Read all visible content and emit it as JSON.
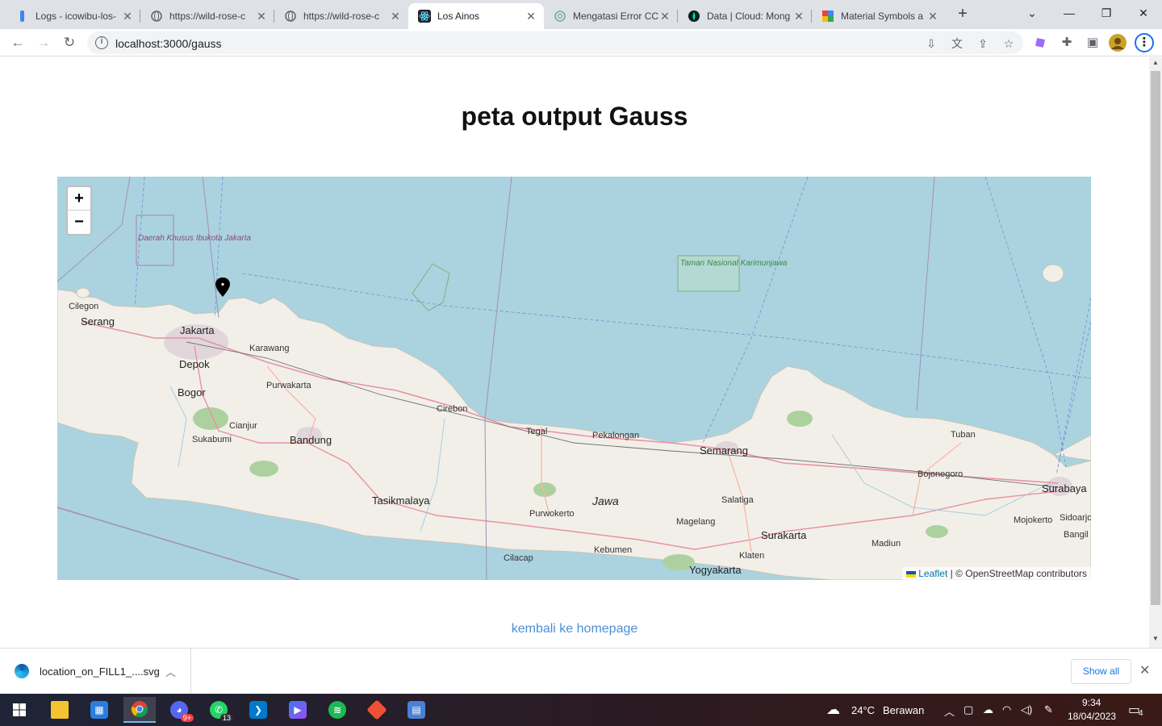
{
  "browser": {
    "tabs": [
      {
        "title": "Logs - icowibu-los-",
        "icon": "gcp-logs-icon"
      },
      {
        "title": "https://wild-rose-c",
        "icon": "globe-icon"
      },
      {
        "title": "https://wild-rose-c",
        "icon": "globe-icon"
      },
      {
        "title": "Los Ainos",
        "icon": "react-icon",
        "active": true
      },
      {
        "title": "Mengatasi Error CC",
        "icon": "openai-icon"
      },
      {
        "title": "Data | Cloud: Mong",
        "icon": "mongodb-icon"
      },
      {
        "title": "Material Symbols a",
        "icon": "material-icon"
      }
    ],
    "url": "localhost:3000/gauss"
  },
  "page": {
    "title": "peta output Gauss",
    "back_link": "kembali ke homepage"
  },
  "map": {
    "zoom_in": "+",
    "zoom_out": "−",
    "attribution_leaflet": "Leaflet",
    "attribution_rest": " | © OpenStreetMap contributors",
    "marker_icon": "location-pin-icon",
    "labels": {
      "dki": "Daerah Khusus Ibukota Jakarta",
      "karimunjawa": "Taman Nasional Karimunjawa",
      "cilegon": "Cilegon",
      "serang": "Serang",
      "jakarta": "Jakarta",
      "karawang": "Karawang",
      "depok": "Depok",
      "bogor": "Bogor",
      "purwakarta": "Purwakarta",
      "cianjur": "Cianjur",
      "sukabumi": "Sukabumi",
      "bandung": "Bandung",
      "cirebon": "Cirebon",
      "tegal": "Tegal",
      "pekalongan": "Pekalongan",
      "semarang": "Semarang",
      "tuban": "Tuban",
      "bojonegoro": "Bojonegoro",
      "surabaya": "Surabaya",
      "tasikmalaya": "Tasikmalaya",
      "jawa": "Jawa",
      "purwokerto": "Purwokerto",
      "salatiga": "Salatiga",
      "magelang": "Magelang",
      "surakarta": "Surakarta",
      "mojokerto": "Mojokerto",
      "sidoarjo": "Sidoarjo",
      "bangil": "Bangil",
      "madiun": "Madiun",
      "cilacap": "Cilacap",
      "kebumen": "Kebumen",
      "klaten": "Klaten",
      "yogyakarta": "Yogyakarta"
    }
  },
  "downloads": {
    "file_name": "location_on_FILL1_....svg",
    "show_all": "Show all"
  },
  "taskbar": {
    "weather": "24°C",
    "weather_desc": "Berawan",
    "time": "9:34",
    "date": "18/04/2023",
    "notification_count": "4",
    "whatsapp_badge": "13",
    "discord_badge": "9+"
  }
}
